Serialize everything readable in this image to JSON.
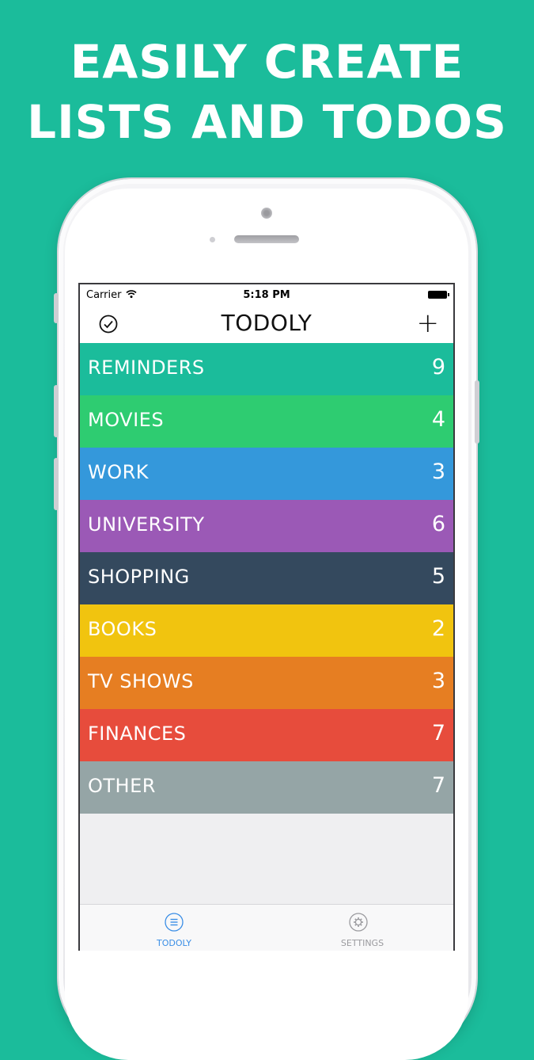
{
  "headline": {
    "line1": "EASILY CREATE",
    "line2": "LISTS AND TODOS"
  },
  "statusbar": {
    "carrier": "Carrier",
    "time": "5:18 PM"
  },
  "navbar": {
    "title": "TODOLY",
    "add_label": "+"
  },
  "lists": [
    {
      "label": "REMINDERS",
      "count": "9",
      "color": "#1bbc9b"
    },
    {
      "label": "MOVIES",
      "count": "4",
      "color": "#2ecc71"
    },
    {
      "label": "WORK",
      "count": "3",
      "color": "#3498db"
    },
    {
      "label": "UNIVERSITY",
      "count": "6",
      "color": "#9b59b6"
    },
    {
      "label": "SHOPPING",
      "count": "5",
      "color": "#34495e"
    },
    {
      "label": "BOOKS",
      "count": "2",
      "color": "#f1c40f"
    },
    {
      "label": "TV SHOWS",
      "count": "3",
      "color": "#e67e22"
    },
    {
      "label": "FINANCES",
      "count": "7",
      "color": "#e74c3c"
    },
    {
      "label": "OTHER",
      "count": "7",
      "color": "#95a5a6"
    }
  ],
  "tabbar": {
    "tabs": [
      {
        "label": "TODOLY",
        "icon": "list-icon",
        "active": true,
        "color": "#3a8ee6"
      },
      {
        "label": "SETTINGS",
        "icon": "gear-icon",
        "active": false,
        "color": "#9a9a9e"
      }
    ]
  },
  "colors": {
    "background": "#1bbc9b",
    "accent": "#3a8ee6"
  }
}
